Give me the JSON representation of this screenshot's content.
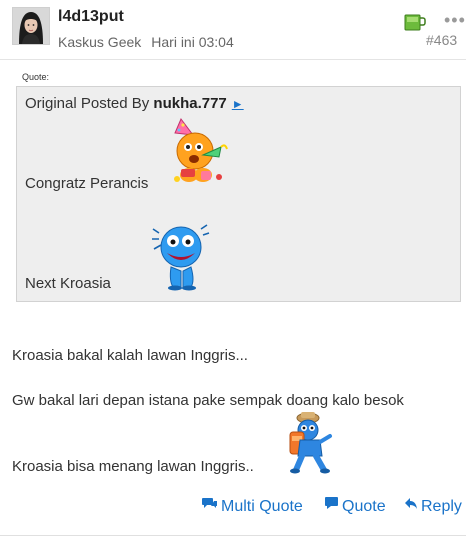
{
  "post": {
    "username": "l4d13put",
    "rank": "Kaskus Geek",
    "time": "Hari ini 03:04",
    "number": "#463",
    "more_icon": "ellipsis-icon",
    "badge_icon": "green-mug-icon"
  },
  "quote": {
    "label": "Quote:",
    "prefix": "Original Posted By",
    "author": "nukha.777",
    "link_icon": "arrow-right-icon",
    "lines": [
      "Congratz Perancis",
      "Next Kroasia"
    ],
    "emoticons": [
      "party-emoticon",
      "crying-emoticon"
    ]
  },
  "body": {
    "lines": [
      "Kroasia bakal kalah lawan Inggris...",
      "Gw bakal lari depan istana pake sempak doang kalo besok",
      "Kroasia bisa menang lawan Inggris.."
    ],
    "emoticon": "hiker-emoticon"
  },
  "actions": {
    "multi_quote": "Multi Quote",
    "quote": "Quote",
    "reply": "Reply"
  },
  "colors": {
    "link": "#1a73c9",
    "quote_bg": "#eeeeee",
    "meta": "#666666"
  }
}
